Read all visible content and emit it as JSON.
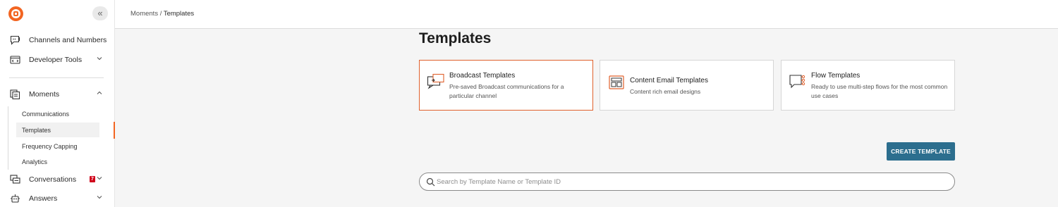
{
  "sidebar": {
    "collapse_icon": "«",
    "items": [
      {
        "label": "Channels and Numbers",
        "icon": "chat-bubble-icon"
      },
      {
        "label": "Developer Tools",
        "icon": "code-window-icon"
      },
      {
        "label": "Moments",
        "icon": "moments-icon"
      },
      {
        "label": "Conversations",
        "icon": "conversations-icon",
        "badge": "7"
      },
      {
        "label": "Answers",
        "icon": "robot-icon"
      }
    ],
    "moments_sub": [
      "Communications",
      "Templates",
      "Frequency Capping",
      "Analytics"
    ],
    "active_sub": "Templates"
  },
  "header": {
    "breadcrumb_parent": "Moments",
    "breadcrumb_sep": " / ",
    "breadcrumb_current": "Templates"
  },
  "main": {
    "title": "Templates",
    "cards": [
      {
        "title": "Broadcast Templates",
        "desc": "Pre-saved Broadcast communications for a particular channel",
        "selected": true,
        "icon": "broadcast-icon"
      },
      {
        "title": "Content Email Templates",
        "desc": "Content rich email designs",
        "selected": false,
        "icon": "email-layout-icon"
      },
      {
        "title": "Flow Templates",
        "desc": "Ready to use multi-step flows for the most common use cases",
        "selected": false,
        "icon": "flow-icon"
      }
    ],
    "create_label": "CREATE TEMPLATE",
    "search_placeholder": "Search by Template Name or Template ID"
  },
  "colors": {
    "accent": "#f26522",
    "primary_button": "#2c6e8e",
    "badge": "#d0021b"
  }
}
